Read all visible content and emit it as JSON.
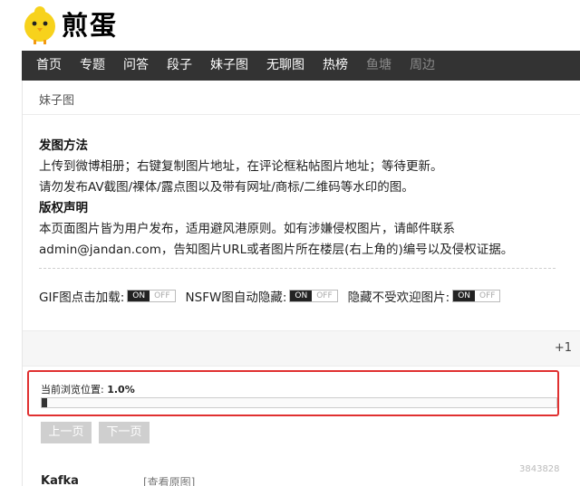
{
  "header": {
    "logo_text": "煎蛋"
  },
  "nav": {
    "items": [
      {
        "label": "首页",
        "dim": false
      },
      {
        "label": "专题",
        "dim": false
      },
      {
        "label": "问答",
        "dim": false
      },
      {
        "label": "段子",
        "dim": false
      },
      {
        "label": "妹子图",
        "dim": false
      },
      {
        "label": "无聊图",
        "dim": false
      },
      {
        "label": "热榜",
        "dim": false
      },
      {
        "label": "鱼塘",
        "dim": true
      },
      {
        "label": "周边",
        "dim": true
      }
    ]
  },
  "page": {
    "tag": "妹子图"
  },
  "rules": {
    "post_heading": "发图方法",
    "post_line1": "上传到微博相册；右键复制图片地址，在评论框粘帖图片地址；等待更新。",
    "post_line2": "请勿发布AV截图/裸体/露点图以及带有网址/商标/二维码等水印的图。",
    "copyright_heading": "版权声明",
    "copyright_line1": "本页面图片皆为用户发布，适用避风港原则。如有涉嫌侵权图片，请邮件联系",
    "copyright_line2": "admin@jandan.com，告知图片URL或者图片所在楼层(右上角的)编号以及侵权证据。"
  },
  "options": [
    {
      "label": "GIF图点击加载:",
      "on": "ON",
      "off": "OFF"
    },
    {
      "label": "NSFW图自动隐藏:",
      "on": "ON",
      "off": "OFF"
    },
    {
      "label": "隐藏不受欢迎图片:",
      "on": "ON",
      "off": "OFF"
    }
  ],
  "toolbar": {
    "plus_label": "+1"
  },
  "progress": {
    "label": "当前浏览位置:",
    "value_text": "1.0%",
    "fraction": 0.01
  },
  "pager": {
    "prev_label": "上一页",
    "next_label": "下一页"
  },
  "comment": {
    "author": "Kafka",
    "view_original": "[查看原图]",
    "id": "3843828"
  },
  "colors": {
    "nav_bg": "#333333",
    "highlight": "#e03030",
    "toggle_on": "#222222"
  }
}
